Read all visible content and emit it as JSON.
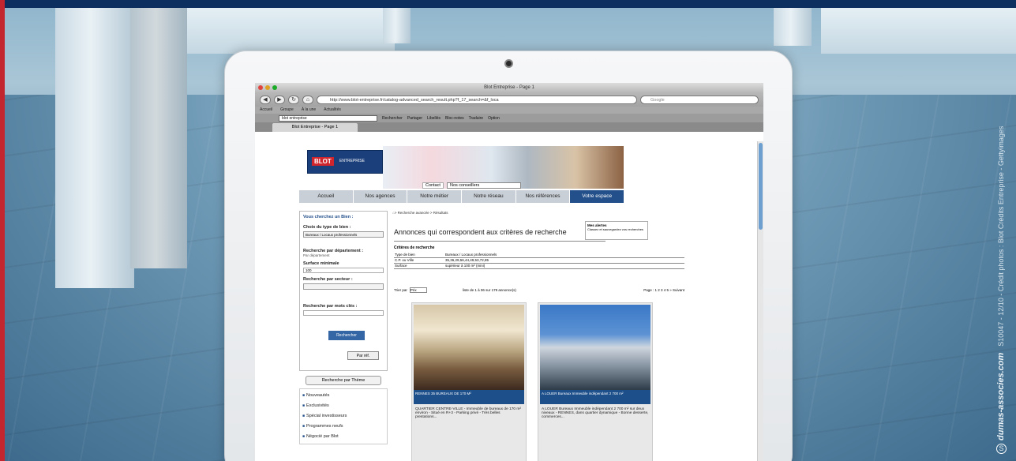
{
  "credit": {
    "brand": "dumas-associes.com",
    "meta": "S10047 - 12/10 - Crédit photos : Blot Crédits Entreprise - Gettyimages"
  },
  "browser": {
    "window_title": "Blot Entreprise - Page 1",
    "url": "http://www.blot-entreprise.fr/catalog-advanced_search_result.php?f_17_search=&f_loca",
    "search_placeholder": "Google",
    "bookmarks": [
      "Accueil",
      "Groupe",
      "À la une",
      "Actualités"
    ],
    "google_toolbar": {
      "query": "blot entreprise",
      "items": [
        "Rechercher",
        "Partager",
        "Libellés",
        "Bloc-notes",
        "Traduire",
        "Option"
      ]
    },
    "tab_label": "Blot Entreprise - Page 1"
  },
  "site": {
    "logo_text": "BLOT",
    "logo_sub": "ENTREPRISE",
    "contact_label": "Contact",
    "contact_select": "Nos conseillers",
    "menu": [
      "Accueil",
      "Nos agences",
      "Notre métier",
      "Notre réseau",
      "Nos références",
      "Votre espace"
    ],
    "active_menu": "Votre espace",
    "search_panel": {
      "title": "Vous cherchez un Bien :",
      "type_label": "Choix du type de bien :",
      "type_value": "Bureaux / Locaux professionnels",
      "dept_label": "Recherche par département :",
      "dept_value": "Par département",
      "surface_label": "Surface minimale",
      "surface_value": "100",
      "sector_label": "Recherche par secteur :",
      "keyword_label": "Recherche par mots clés :",
      "submit": "Rechercher",
      "ref_button": "Par réf."
    },
    "theme_button": "Recherche par Thème",
    "theme_links": [
      "Nouveautés",
      "Exclusivités",
      "Spécial investisseurs",
      "Programmes neufs",
      "Négocié par Blot"
    ],
    "breadcrumb": "> Recherche avancée > Résultats",
    "results_title": "Annonces qui correspondent aux critères de recherche",
    "alert_title": "Mes alertes",
    "alert_text": "Classez et sauvegardez vos recherches",
    "criteria_title": "Critères de recherche",
    "criteria": [
      {
        "k": "Type de bien",
        "v": "Bureaux / Locaux professionnels"
      },
      {
        "k": "C.P. ou Ville",
        "v": "35,36,29,56,44,49,53,72,85"
      },
      {
        "k": "Surface",
        "v": "supérieur à 100 m² (mini)"
      }
    ],
    "sort_label": "Trier par",
    "sort_value": "Prix",
    "count_text": "liste de 1 à 06 sur 179 annonce(s)",
    "pagination": "Page : 1 2 3 4 5 » Suivant",
    "cards": [
      {
        "caption": "RENNES 35 BUREAUX DE 170 M²",
        "text": "QUARTIER CENTRE-VILLE - Immeuble de bureaux de 170 m² environ - Situé en R+3 - Parking privé - Très belles prestations..."
      },
      {
        "caption": "A LOUER Bureaux Immeuble indépendant 2 700 m²",
        "text": "A LOUER Bureaux Immeuble indépendant 2 700 m² sur deux niveaux - RENNES, dans quartier dynamique - Bonne desserte, commerces..."
      }
    ]
  }
}
